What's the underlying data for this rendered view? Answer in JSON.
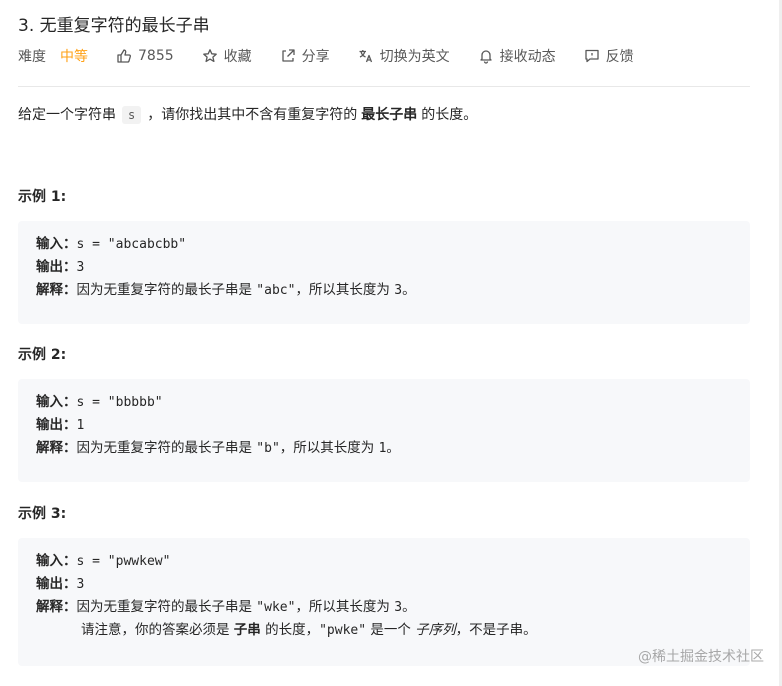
{
  "problem": {
    "title": "3. 无重复字符的最长子串",
    "difficulty_label": "难度",
    "difficulty": "中等",
    "likes": "7855",
    "collect": "收藏",
    "share": "分享",
    "switch_lang": "切换为英文",
    "subscribe": "接收动态",
    "feedback": "反馈"
  },
  "description": {
    "prefix": "给定一个字符串",
    "var": "s",
    "middle": "，请你找出其中不含有重复字符的",
    "bold": "最长子串",
    "suffix": "的长度。"
  },
  "examples": [
    {
      "title": "示例 1:",
      "input_label": "输入：",
      "input": "s = \"abcabcbb\"",
      "output_label": "输出：",
      "output": "3",
      "explain_label": "解释：",
      "explain_text": "因为无重复字符的最长子串是",
      "explain_code": "\"abc\"",
      "explain_mid": "，所以其长度为",
      "explain_num": "3",
      "explain_end": "。"
    },
    {
      "title": "示例 2:",
      "input_label": "输入：",
      "input": "s = \"bbbbb\"",
      "output_label": "输出：",
      "output": "1",
      "explain_label": "解释：",
      "explain_text": "因为无重复字符的最长子串是",
      "explain_code": "\"b\"",
      "explain_mid": "，所以其长度为",
      "explain_num": "1",
      "explain_end": "。"
    },
    {
      "title": "示例 3:",
      "input_label": "输入：",
      "input": "s = \"pwwkew\"",
      "output_label": "输出：",
      "output": "3",
      "explain_label": "解释：",
      "explain_text": "因为无重复字符的最长子串是",
      "explain_code": "\"wke\"",
      "explain_mid": "，所以其长度为",
      "explain_num": "3",
      "explain_end": "。",
      "note_prefix": "请注意，你的答案必须是",
      "note_bold": "子串",
      "note_mid": "的长度，",
      "note_code": "\"pwke\"",
      "note_is": "是一个",
      "note_italic": "子序列",
      "note_end": "，不是子串。"
    }
  ],
  "watermark": "@稀土掘金技术社区",
  "colors": {
    "difficulty_medium": "#ffa116",
    "example_bg": "#f7f8fa",
    "divider": "#e8e8e8"
  },
  "icons": [
    "thumbs-up-icon",
    "star-icon",
    "share-icon",
    "translate-icon",
    "bell-icon",
    "feedback-icon"
  ]
}
